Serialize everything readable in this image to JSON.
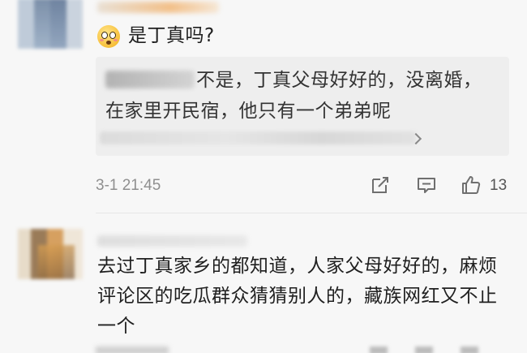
{
  "comments": [
    {
      "text": "是丁真吗?",
      "reply": {
        "line1": "不是，丁真父母好好的，没离婚，",
        "line2": "在家里开民宿，他只有一个弟弟呢"
      },
      "timestamp": "3-1 21:45",
      "like_count": "13"
    },
    {
      "text": "去过丁真家乡的都知道，人家父母好好的，麻烦评论区的吃瓜群众猜猜别人的，藏族网红又不止一个"
    }
  ],
  "icons": {
    "emoji": "flushed-face-emoji",
    "share": "share-icon",
    "comment": "comment-icon",
    "like": "thumbs-up-icon",
    "reply_more": "chevron-right-icon"
  },
  "colors": {
    "background": "#f7f7f7",
    "reply_background": "#eeeeee",
    "meta_text": "#8f8f8f",
    "body_text": "#1f1f1f"
  }
}
